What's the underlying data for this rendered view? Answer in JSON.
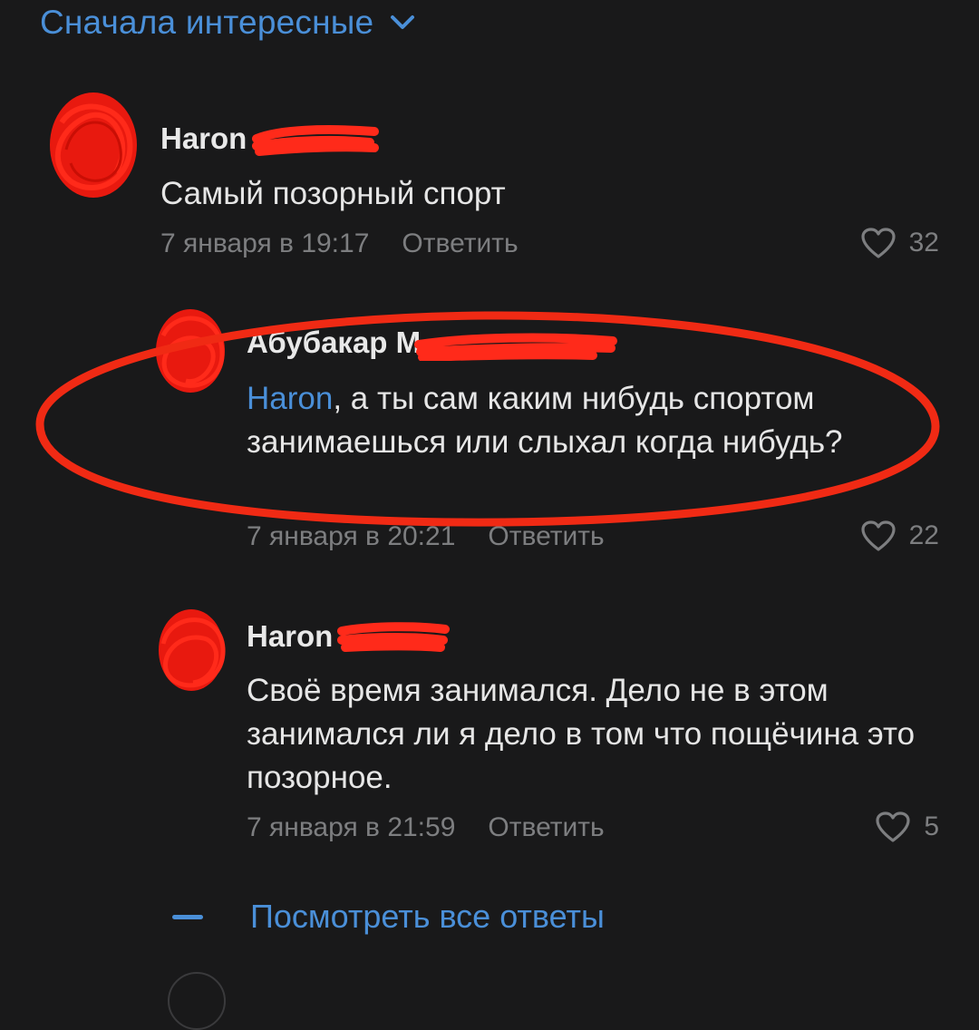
{
  "sort_label": "Сначала интересные",
  "comments": [
    {
      "author": "Haron",
      "text": "Самый позорный спорт",
      "date": "7 января в 19:17",
      "reply_label": "Ответить",
      "likes": "32"
    },
    {
      "author": "Абубакар М",
      "mention": "Haron",
      "text_after_mention": ", а ты сам каким нибудь спортом занимаешься или слыхал когда нибудь?",
      "date": "7 января в 20:21",
      "reply_label": "Ответить",
      "likes": "22"
    },
    {
      "author": "Haron",
      "text": "Своё время занимался. Дело не в этом занимался ли я дело в том что пощёчина это позорное.",
      "date": "7 января в 21:59",
      "reply_label": "Ответить",
      "likes": "5"
    }
  ],
  "show_all_label": "Посмотреть все ответы",
  "colors": {
    "background": "#19191a",
    "accent": "#4a8fd8",
    "redaction": "#ff2a1a"
  }
}
